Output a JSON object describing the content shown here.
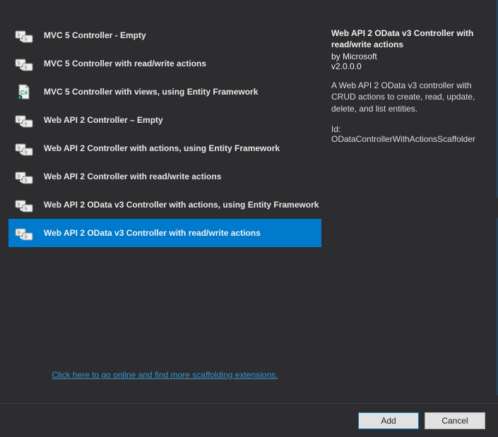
{
  "scaffolds": [
    {
      "label": "MVC 5 Controller - Empty",
      "icon": "controller"
    },
    {
      "label": "MVC 5 Controller with read/write actions",
      "icon": "controller"
    },
    {
      "label": "MVC 5 Controller with views, using Entity Framework",
      "icon": "cs-file"
    },
    {
      "label": "Web API 2 Controller – Empty",
      "icon": "controller"
    },
    {
      "label": "Web API 2 Controller with actions, using Entity Framework",
      "icon": "controller"
    },
    {
      "label": "Web API 2 Controller with read/write actions",
      "icon": "controller"
    },
    {
      "label": "Web API 2 OData v3 Controller with actions, using Entity Framework",
      "icon": "controller"
    },
    {
      "label": "Web API 2 OData v3 Controller with read/write actions",
      "icon": "controller"
    }
  ],
  "selected_index": 7,
  "detail": {
    "title": "Web API 2 OData v3 Controller with read/write actions",
    "author": "by Microsoft",
    "version": "v2.0.0.0",
    "description": "A Web API 2 OData v3 controller with CRUD actions to create, read, update, delete, and list entities.",
    "id_label": "Id: ODataControllerWithActionsScaffolder"
  },
  "extensions_link": "Click here to go online and find more scaffolding extensions.",
  "buttons": {
    "add": "Add",
    "cancel": "Cancel"
  }
}
